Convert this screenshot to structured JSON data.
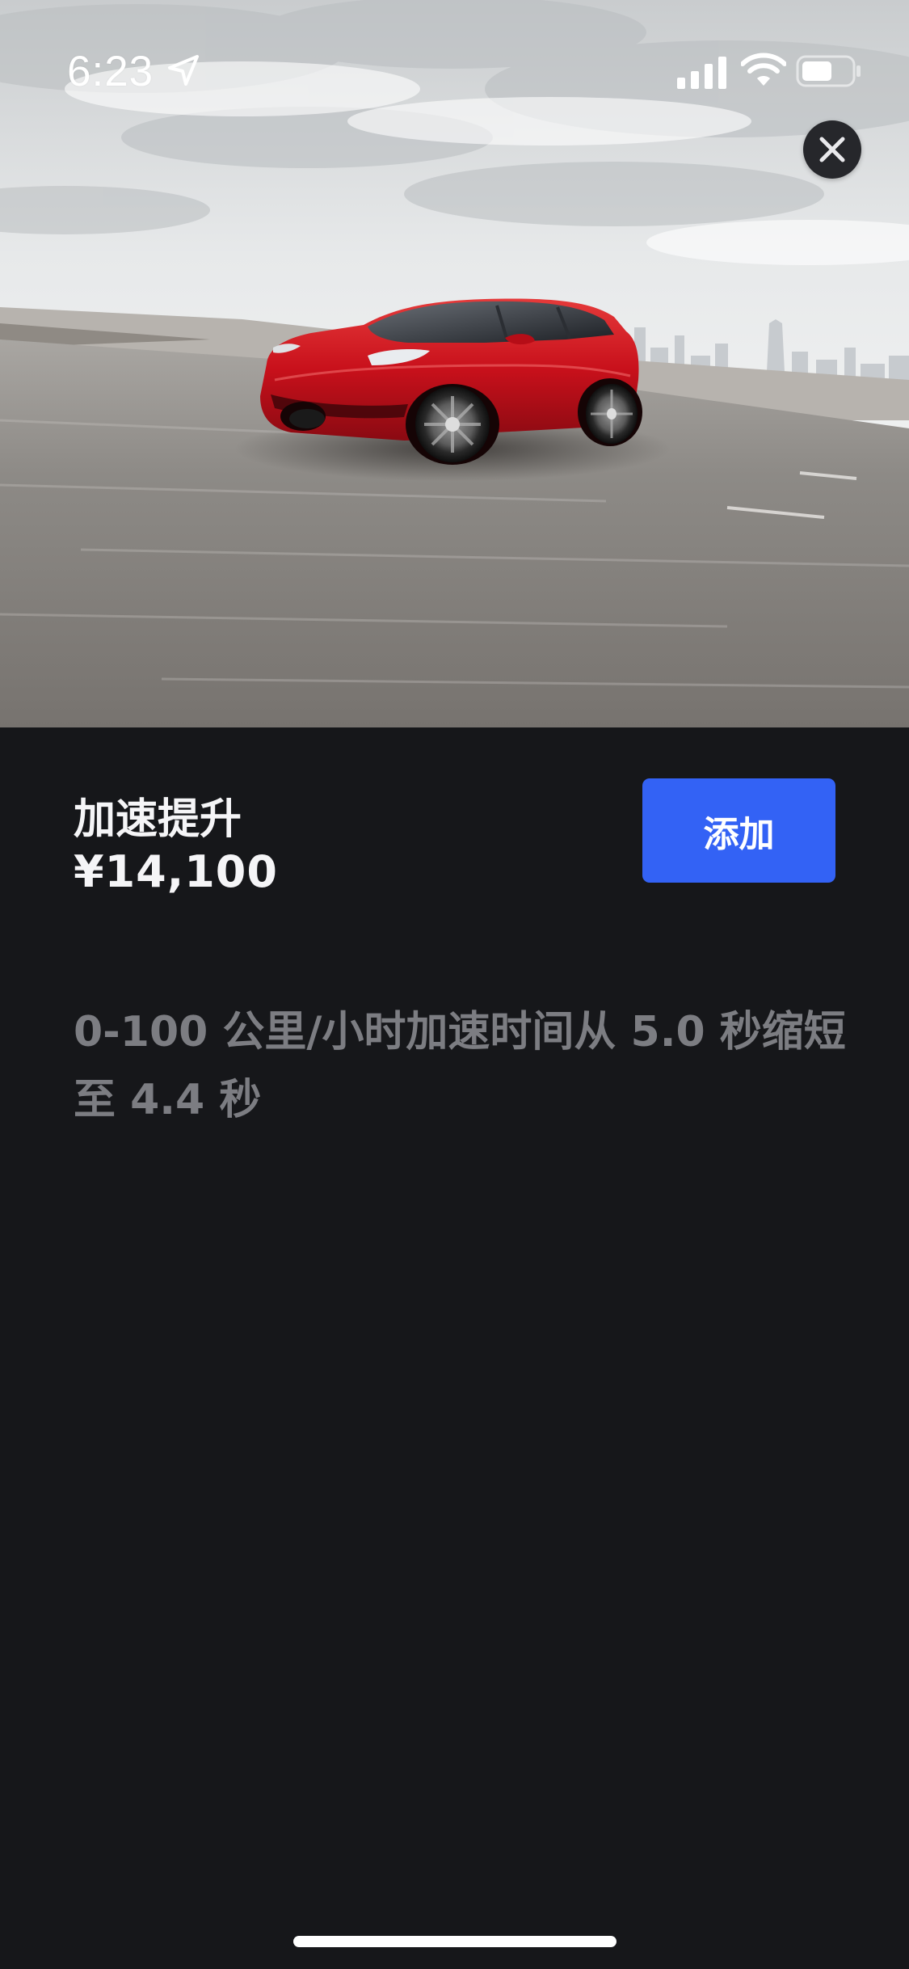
{
  "status_bar": {
    "time": "6:23",
    "icons": [
      "location-arrow-icon",
      "cellular-signal-icon",
      "wifi-icon",
      "battery-icon"
    ]
  },
  "hero": {
    "image": "red-suv-driving-on-road-city-skyline",
    "close_icon": "close-icon"
  },
  "option": {
    "title": "加速提升",
    "price": "¥14,100",
    "add_label": "添加",
    "description": "0-100 公里/小时加速时间从 5.0 秒缩短至 4.4 秒"
  },
  "colors": {
    "background": "#16171a",
    "accent_button": "#3362f5",
    "title_text": "#f5f5f7",
    "description_text": "#7c7d82",
    "car_red": "#c8101b"
  }
}
